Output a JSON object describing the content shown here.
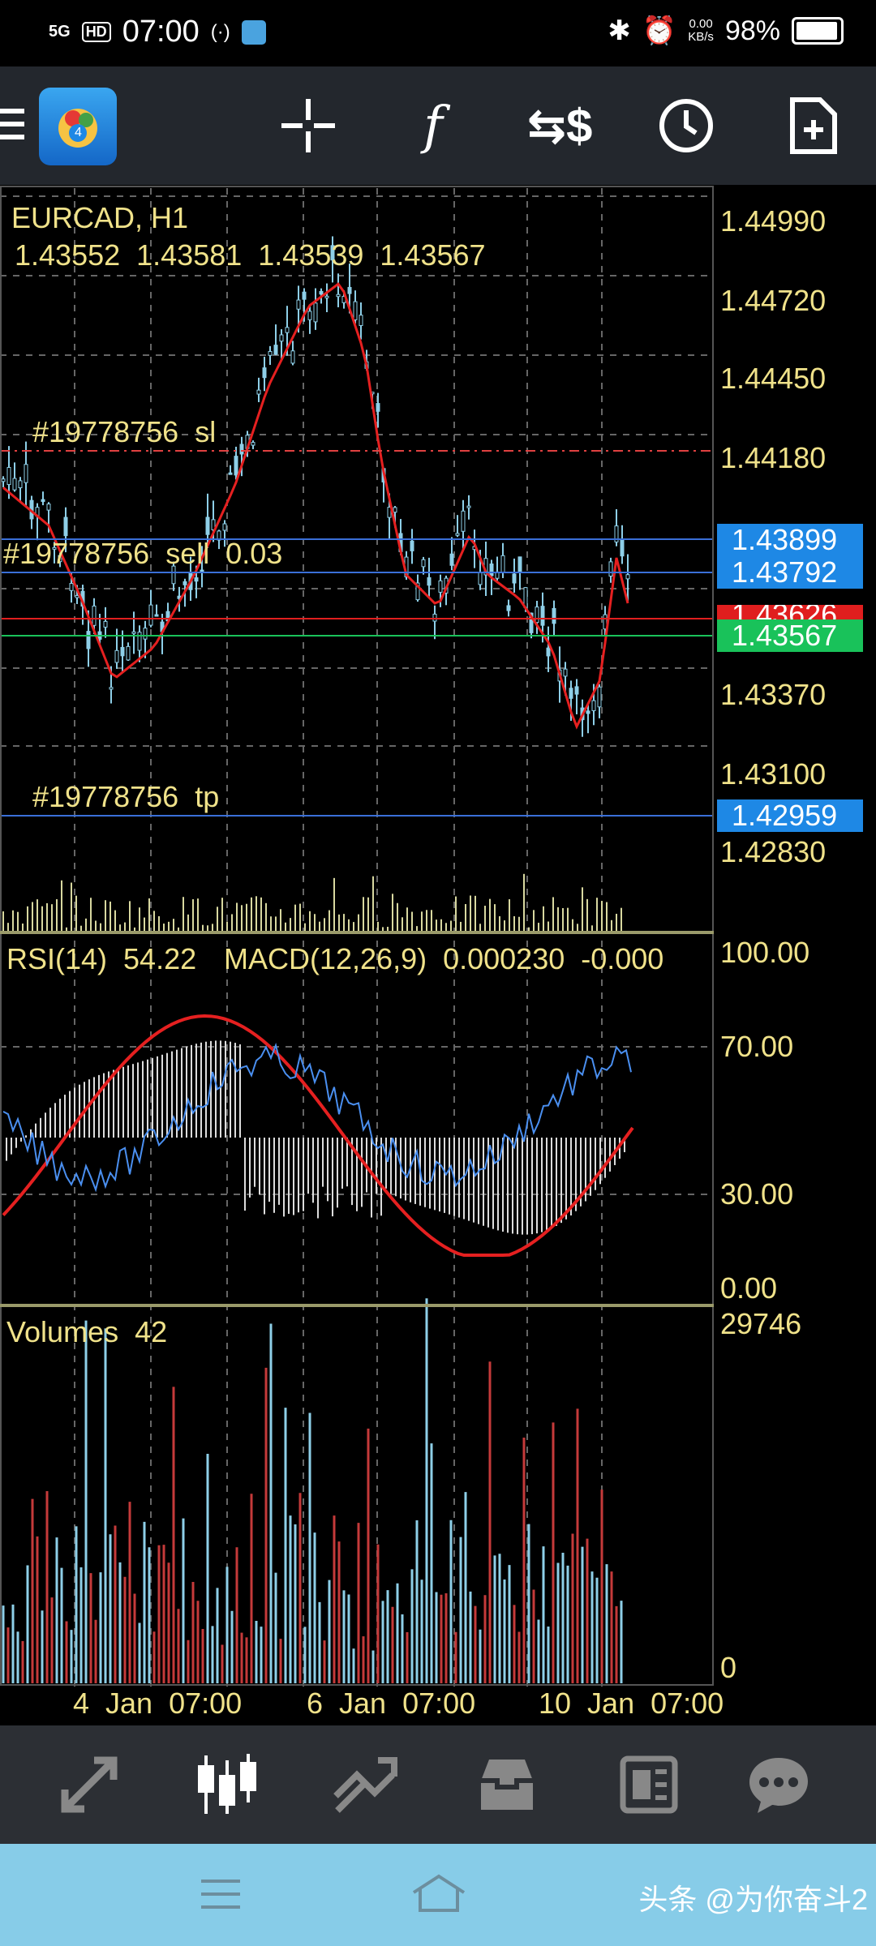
{
  "status_bar": {
    "network": "5G",
    "hd": "HD",
    "time": "07:00",
    "speed_value": "0.00",
    "speed_unit": "KB/s",
    "battery": "98%"
  },
  "toolbar": {
    "icons": [
      "menu-icon",
      "metatrader-logo",
      "crosshair-icon",
      "function-icon",
      "trade-dollar-icon",
      "clock-icon",
      "new-document-icon"
    ]
  },
  "chart": {
    "symbol": "EURCAD, H1",
    "ohlc": "1.43552  1.43581  1.43539  1.43567",
    "sl_label": "#19778756  sl",
    "order_label": "#19778756  sell  0.03",
    "tp_label": "#19778756  tp",
    "price_axis": [
      "1.44990",
      "1.44720",
      "1.44450",
      "1.44180",
      "1.43370",
      "1.43100",
      "1.42830"
    ],
    "tags": {
      "t1": "1.43899",
      "t2": "1.43792",
      "t3": "1.43626",
      "current": "1.43567",
      "tp": "1.42959"
    },
    "colors": {
      "blue_tag": "#1e88e5",
      "red_tag": "#e01e1e",
      "green_tag": "#19c25a",
      "ma_red": "#e52020",
      "candle_blue": "#8ecfe8"
    }
  },
  "indicator": {
    "rsi_label": "RSI(14)  54.22",
    "macd_label": "MACD(12,26,9)  0.000230  -0.000",
    "levels": [
      "100.00",
      "70.00",
      "30.00",
      "0.00"
    ]
  },
  "volumes": {
    "label": "Volumes  42",
    "max": "29746",
    "min": "0"
  },
  "time_axis": [
    "4  Jan  07:00",
    "6  Jan  07:00",
    "10  Jan  07:00"
  ],
  "bottom_nav": {
    "items": [
      "quotes-icon",
      "chart-icon",
      "trade-icon",
      "history-icon",
      "news-icon",
      "chat-icon"
    ]
  },
  "watermark": "头条 @为你奋斗2"
}
